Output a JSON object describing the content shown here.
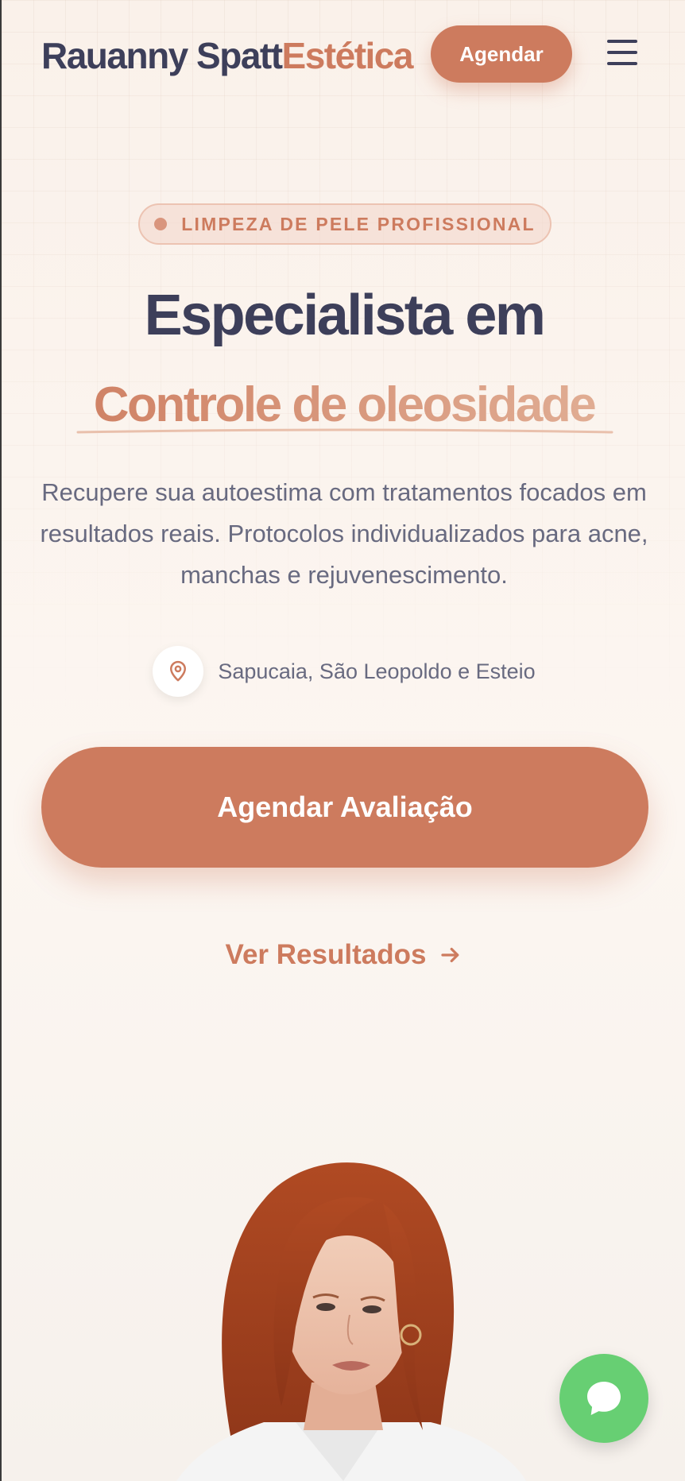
{
  "header": {
    "logo_name": "Rauanny Spatt",
    "logo_accent": "Estética",
    "cta_label": "Agendar",
    "menu_icon": "hamburger-icon"
  },
  "hero": {
    "badge": "LIMPEZA DE PELE PROFISSIONAL",
    "title": "Especialista em",
    "subtitle": "Controle de oleosidade",
    "lead": "Recupere sua autoestima com tratamentos focados em resultados reais. Protocolos individualizados para acne, manchas e rejuvenescimento.",
    "location": "Sapucaia, São Leopoldo e Esteio",
    "primary_cta": "Agendar Avaliação",
    "secondary_cta": "Ver Resultados"
  },
  "floating": {
    "whatsapp_icon": "chat-bubble-icon"
  },
  "colors": {
    "accent": "#cd7b5e",
    "text_dark": "#3d3f5a",
    "text_muted": "#686a80",
    "whatsapp": "#67cf73",
    "background": "#fbf4ee"
  }
}
